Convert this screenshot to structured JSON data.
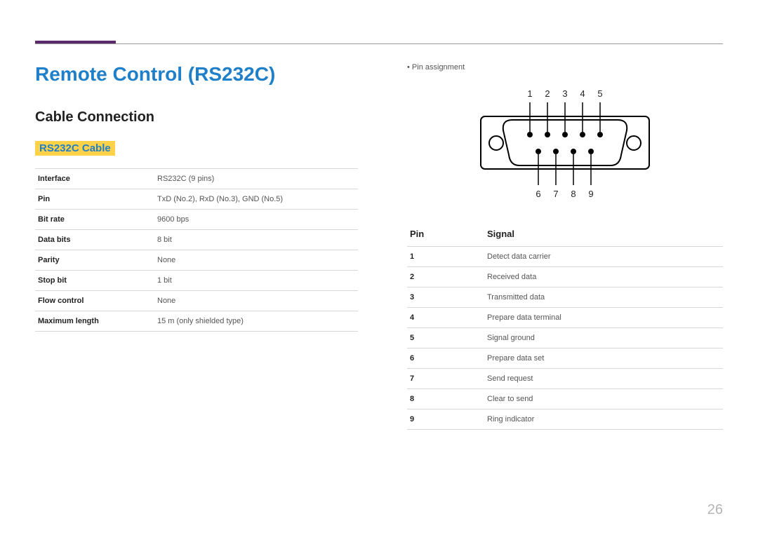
{
  "page_number": "26",
  "title": "Remote Control (RS232C)",
  "subheading": "Cable Connection",
  "section_label": "RS232C Cable",
  "spec_rows": [
    {
      "k": "Interface",
      "v": "RS232C (9 pins)"
    },
    {
      "k": "Pin",
      "v": "TxD (No.2), RxD (No.3), GND (No.5)"
    },
    {
      "k": "Bit rate",
      "v": "9600 bps"
    },
    {
      "k": "Data bits",
      "v": "8 bit"
    },
    {
      "k": "Parity",
      "v": "None"
    },
    {
      "k": "Stop bit",
      "v": "1 bit"
    },
    {
      "k": "Flow control",
      "v": "None"
    },
    {
      "k": "Maximum length",
      "v": "15 m (only shielded type)"
    }
  ],
  "assignment_bullet": "Pin assignment",
  "diagram": {
    "top_labels": [
      "1",
      "2",
      "3",
      "4",
      "5"
    ],
    "bottom_labels": [
      "6",
      "7",
      "8",
      "9"
    ]
  },
  "pin_table": {
    "header_pin": "Pin",
    "header_signal": "Signal",
    "rows": [
      {
        "pin": "1",
        "signal": "Detect data carrier"
      },
      {
        "pin": "2",
        "signal": "Received data"
      },
      {
        "pin": "3",
        "signal": "Transmitted data"
      },
      {
        "pin": "4",
        "signal": "Prepare data terminal"
      },
      {
        "pin": "5",
        "signal": "Signal ground"
      },
      {
        "pin": "6",
        "signal": "Prepare data set"
      },
      {
        "pin": "7",
        "signal": "Send request"
      },
      {
        "pin": "8",
        "signal": "Clear to send"
      },
      {
        "pin": "9",
        "signal": "Ring indicator"
      }
    ]
  }
}
